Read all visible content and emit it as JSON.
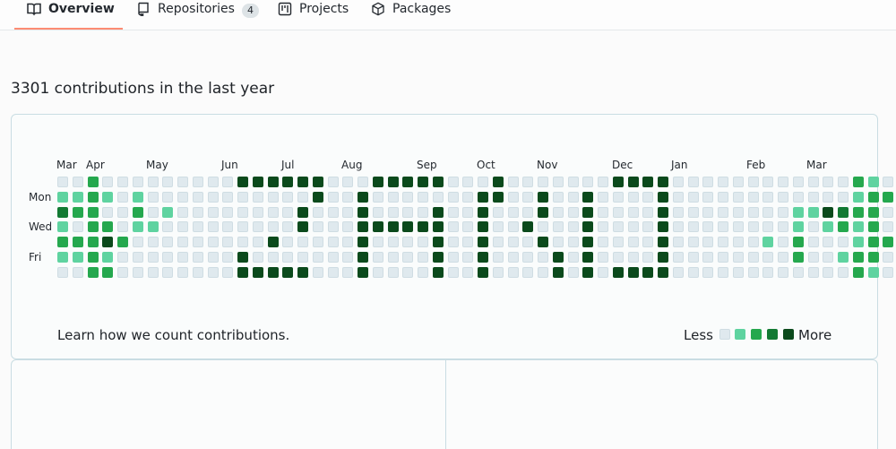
{
  "tabs": [
    {
      "label": "Overview",
      "icon": "book-icon",
      "active": true
    },
    {
      "label": "Repositories",
      "icon": "repo-icon",
      "count": "4"
    },
    {
      "label": "Projects",
      "icon": "project-icon"
    },
    {
      "label": "Packages",
      "icon": "package-icon"
    }
  ],
  "heading": "3301 contributions in the last year",
  "months": [
    "Mar",
    "Apr",
    "May",
    "Jun",
    "Jul",
    "Aug",
    "Sep",
    "Oct",
    "Nov",
    "Dec",
    "Jan",
    "Feb",
    "Mar"
  ],
  "days": [
    "Mon",
    "Wed",
    "Fri"
  ],
  "grid": [
    [
      0,
      0,
      2,
      0,
      0,
      0,
      0,
      0,
      0,
      0,
      0,
      0,
      4,
      4,
      4,
      4,
      4,
      4,
      0,
      0,
      0,
      4,
      4,
      4,
      4,
      4,
      0,
      0,
      0,
      4,
      0,
      0,
      0,
      0,
      0,
      0,
      0,
      4,
      4,
      4,
      4,
      0,
      0,
      0,
      0,
      0,
      0,
      0,
      0,
      0,
      0,
      0,
      0,
      2,
      1,
      0
    ],
    [
      1,
      1,
      2,
      1,
      0,
      1,
      0,
      0,
      0,
      0,
      0,
      0,
      0,
      0,
      0,
      0,
      0,
      4,
      0,
      0,
      4,
      0,
      0,
      0,
      0,
      0,
      0,
      0,
      4,
      4,
      0,
      0,
      4,
      0,
      0,
      4,
      0,
      0,
      0,
      0,
      4,
      0,
      0,
      0,
      0,
      0,
      0,
      0,
      0,
      0,
      0,
      0,
      0,
      1,
      2,
      2
    ],
    [
      3,
      2,
      2,
      0,
      0,
      2,
      0,
      1,
      0,
      0,
      0,
      0,
      0,
      0,
      0,
      0,
      4,
      0,
      0,
      0,
      4,
      0,
      0,
      0,
      0,
      4,
      0,
      0,
      4,
      0,
      0,
      0,
      4,
      0,
      0,
      4,
      0,
      0,
      0,
      0,
      4,
      0,
      0,
      0,
      0,
      0,
      0,
      0,
      0,
      1,
      1,
      4,
      3,
      2,
      2,
      0
    ],
    [
      1,
      0,
      2,
      2,
      0,
      1,
      1,
      0,
      0,
      0,
      0,
      0,
      0,
      0,
      0,
      0,
      4,
      0,
      0,
      0,
      4,
      4,
      4,
      4,
      4,
      4,
      0,
      0,
      4,
      0,
      0,
      4,
      0,
      0,
      0,
      4,
      0,
      0,
      0,
      0,
      4,
      0,
      0,
      0,
      0,
      0,
      0,
      0,
      0,
      1,
      0,
      1,
      2,
      1,
      2,
      0
    ],
    [
      2,
      2,
      2,
      4,
      2,
      0,
      0,
      0,
      0,
      0,
      0,
      0,
      0,
      0,
      4,
      0,
      0,
      0,
      0,
      0,
      4,
      0,
      0,
      0,
      0,
      4,
      0,
      0,
      4,
      0,
      0,
      0,
      4,
      0,
      0,
      4,
      0,
      0,
      0,
      0,
      4,
      0,
      0,
      0,
      0,
      0,
      0,
      1,
      0,
      2,
      0,
      0,
      0,
      1,
      2,
      2
    ],
    [
      1,
      1,
      2,
      1,
      0,
      0,
      0,
      0,
      0,
      0,
      0,
      0,
      4,
      0,
      0,
      0,
      0,
      0,
      0,
      0,
      4,
      0,
      0,
      0,
      0,
      4,
      0,
      0,
      4,
      0,
      0,
      0,
      0,
      4,
      0,
      4,
      0,
      0,
      0,
      0,
      4,
      0,
      0,
      0,
      0,
      0,
      0,
      0,
      0,
      2,
      0,
      0,
      1,
      2,
      2,
      0
    ],
    [
      0,
      0,
      2,
      2,
      0,
      0,
      0,
      0,
      0,
      0,
      0,
      0,
      4,
      4,
      4,
      4,
      4,
      0,
      0,
      0,
      4,
      0,
      0,
      0,
      0,
      4,
      0,
      0,
      4,
      0,
      0,
      0,
      0,
      4,
      0,
      4,
      0,
      4,
      4,
      4,
      4,
      0,
      0,
      0,
      0,
      0,
      0,
      0,
      0,
      0,
      0,
      0,
      0,
      2,
      1,
      0
    ]
  ],
  "learn_link": "Learn how we count contributions.",
  "legend": {
    "less": "Less",
    "more": "More"
  },
  "colors": {
    "level0": "#dfe9ee",
    "level1": "#5fd3a0",
    "level2": "#25a84e",
    "level3": "#127a33",
    "level4": "#0b4a1c",
    "tab_underline": "#fd8c73"
  }
}
